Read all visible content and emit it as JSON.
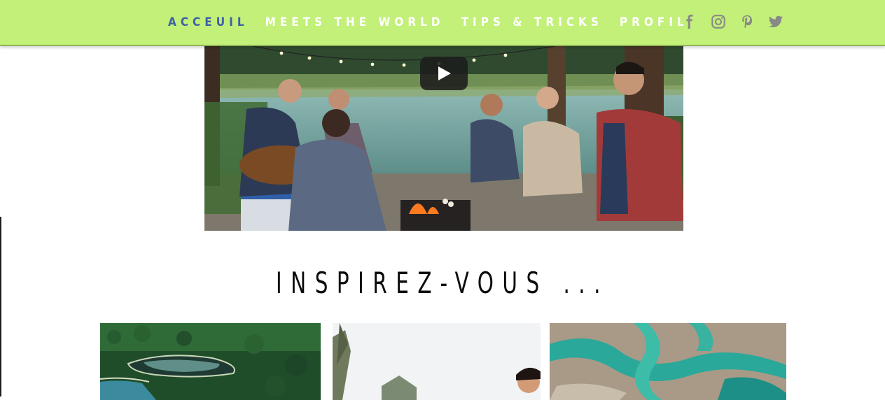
{
  "nav": {
    "items": [
      {
        "label": "ACCEUIL",
        "active": true
      },
      {
        "label": "MEETS THE WORLD",
        "active": false
      },
      {
        "label": "TIPS & TRICKS",
        "active": false
      },
      {
        "label": "PROFIL",
        "active": false
      }
    ],
    "active_color": "#3f5fa6",
    "inactive_color": "#ffffff"
  },
  "header": {
    "background": "#c2f079"
  },
  "socials": [
    {
      "icon": "facebook-icon"
    },
    {
      "icon": "instagram-icon"
    },
    {
      "icon": "pinterest-icon"
    },
    {
      "icon": "twitter-icon"
    }
  ],
  "video": {
    "play_icon": "play-icon"
  },
  "section": {
    "heading": "INSPIREZ-VOUS ..."
  },
  "gallery": [
    {
      "icon": "forest-lake-photo"
    },
    {
      "icon": "smiling-woman-photo"
    },
    {
      "icon": "aerial-river-photo"
    }
  ]
}
